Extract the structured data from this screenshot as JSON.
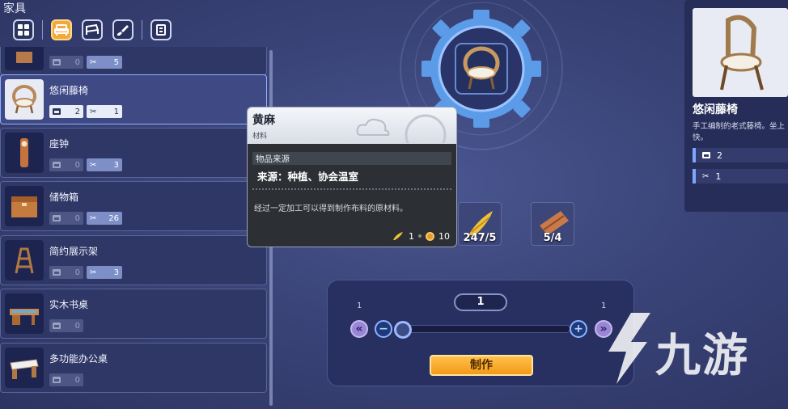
{
  "header": {
    "title": "家具"
  },
  "categories": [
    {
      "icon": "grid-icon",
      "active": false
    },
    {
      "icon": "sofa-icon",
      "active": true
    },
    {
      "icon": "bed-icon",
      "active": false
    },
    {
      "icon": "brush-icon",
      "active": false
    },
    {
      "icon": "wardrobe-icon",
      "active": false
    }
  ],
  "items": [
    {
      "name": "",
      "owned": "0",
      "craftable": "5",
      "selected": false
    },
    {
      "name": "悠闲藤椅",
      "owned": "2",
      "craftable": "1",
      "selected": true
    },
    {
      "name": "座钟",
      "owned": "0",
      "craftable": "3",
      "selected": false
    },
    {
      "name": "储物箱",
      "owned": "0",
      "craftable": "26",
      "selected": false
    },
    {
      "name": "简约展示架",
      "owned": "0",
      "craftable": "3",
      "selected": false
    },
    {
      "name": "实木书桌",
      "owned": "0",
      "craftable": "",
      "selected": false
    },
    {
      "name": "多功能办公桌",
      "owned": "0",
      "craftable": "",
      "selected": false
    }
  ],
  "detail": {
    "name": "悠闲藤椅",
    "desc": "手工编制的老式藤椅。坐上快。",
    "owned": "2",
    "craftable": "1"
  },
  "tooltip": {
    "name": "黄麻",
    "type": "材料",
    "section": "物品来源",
    "source": "来源：种植、协会温室",
    "desc": "经过一定加工可以得到制作布料的原材料。",
    "count": "1",
    "price": "10"
  },
  "materials": [
    {
      "icon": "jute-icon",
      "count": "247/5"
    },
    {
      "icon": "wood-icon",
      "count": "5/4"
    }
  ],
  "craft": {
    "quantity": "1",
    "min": "1",
    "max": "1",
    "button": "制作"
  },
  "watermark": {
    "text": "九游"
  },
  "colors": {
    "accent": "#f3a93a",
    "selected": "#8fb2ff"
  }
}
